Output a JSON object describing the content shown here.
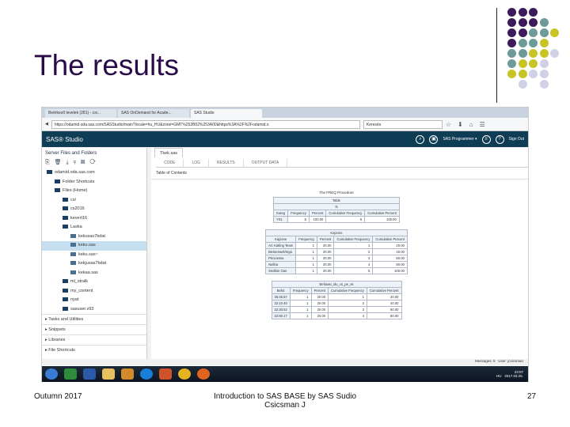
{
  "slide": {
    "title": "The results",
    "footer_left": "Outumn 2017",
    "footer_center_1": "Introduction to SAS BASE by SAS Sudio",
    "footer_center_2": "Csicsman J",
    "page_number": "27"
  },
  "colors": {
    "purple": "#3d1a5b",
    "teal": "#6e9a9a",
    "yellow": "#c8c425",
    "lavender": "#d0d0e6",
    "sas_header": "#0f3d55"
  },
  "browser": {
    "tabs": [
      "Beérkező levelek (281) - csi...",
      "SAS OnDemand for Acade...",
      "SAS Studio"
    ],
    "url": "https://odamid.oda.sas.com/SASStudio/main?locale=hu_HU&zone=GMT%252B02%253A00&https%3A%2F%2Fodamid.o",
    "search_placeholder": "Keresés"
  },
  "sas": {
    "brand": "SAS® Studio",
    "perspective": "SAS Programmer ▾",
    "sign_out": "Sign Out"
  },
  "left_panel": {
    "header": "Server Files and Folders",
    "tree": [
      {
        "label": "odamid.oda.sas.com",
        "indent": 0
      },
      {
        "label": "Folder Shortcuts",
        "indent": 1
      },
      {
        "label": "Files (Home)",
        "indent": 1
      },
      {
        "label": "csl",
        "indent": 2
      },
      {
        "label": "cs2016",
        "indent": 2
      },
      {
        "label": "kevert16",
        "indent": 2
      },
      {
        "label": "Laska",
        "indent": 2
      },
      {
        "label": "kekusas7bdat",
        "indent": 3
      },
      {
        "label": "keku.sas",
        "indent": 3,
        "selected": true
      },
      {
        "label": "keku.sas~",
        "indent": 3
      },
      {
        "label": "kekjusas7bdat",
        "indent": 3
      },
      {
        "label": "kekaa.sas",
        "indent": 3
      },
      {
        "label": "ml_stralk",
        "indent": 2
      },
      {
        "label": "my_content",
        "indent": 2
      },
      {
        "label": "nyat",
        "indent": 2
      },
      {
        "label": "sasuser.v93",
        "indent": 2
      }
    ],
    "sections": [
      "Tasks and Utilities",
      "Snippets",
      "Libraries",
      "File Shortcuts"
    ]
  },
  "editor": {
    "file_tab": "Tkek.sas",
    "subtabs": [
      "CODE",
      "LOG",
      "RESULTS",
      "OUTPUT DATA"
    ],
    "toc": "Table of Contents",
    "procedure_title": "The FREQ Procedure",
    "table1": {
      "caption": "Table",
      "sub": "N",
      "headers": [
        "Kateg",
        "Frequency",
        "Percent",
        "Cumulative Frequency",
        "Cumulative Percent"
      ],
      "rows": [
        [
          "Y01",
          "5",
          "100.00",
          "5",
          "100.00"
        ]
      ]
    },
    "table2": {
      "caption": "Kajzone",
      "headers": [
        "Kajzone",
        "Frequency",
        "Percent",
        "Cumulative Frequency",
        "Cumulative Percent"
      ],
      "rows": [
        [
          "AC Katling Team",
          "1",
          "20.00",
          "1",
          "20.00"
        ],
        [
          "Besserwelt/Inga",
          "1",
          "20.00",
          "2",
          "40.00"
        ],
        [
          "Princiessa",
          "1",
          "20.00",
          "3",
          "60.00"
        ],
        [
          "Nafina",
          "1",
          "20.00",
          "4",
          "80.00"
        ],
        [
          "Sedtlon Oas",
          "1",
          "20.00",
          "5",
          "100.00"
        ]
      ]
    },
    "table3": {
      "caption": "Befutasi_ido_cs_pe_ss",
      "headers": [
        "Befut",
        "Frequency",
        "Percent",
        "Cumulative Frequency",
        "Cumulative Percent"
      ],
      "rows": [
        [
          "36:45.57",
          "1",
          "20.00",
          "1",
          "20.00"
        ],
        [
          "22:10.40",
          "1",
          "20.00",
          "2",
          "40.00"
        ],
        [
          "22:20.52",
          "1",
          "20.00",
          "3",
          "60.00"
        ],
        [
          "22:50.17",
          "1",
          "20.00",
          "4",
          "80.00"
        ]
      ]
    }
  },
  "statusbar": {
    "messages": "Messages: 5",
    "user": "User: jcsicsman"
  },
  "taskbar": {
    "lang": "HU",
    "time": "23:07",
    "date": "2017.03.25."
  }
}
